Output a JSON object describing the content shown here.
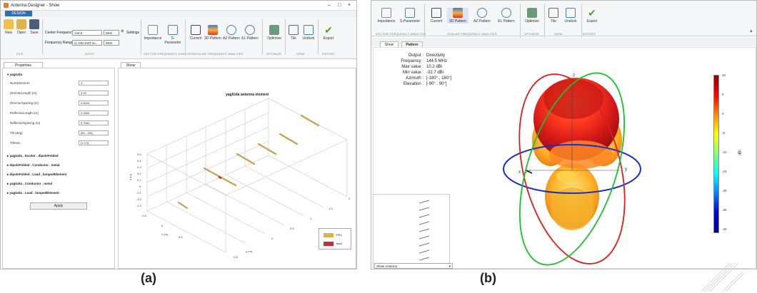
{
  "panel_a": {
    "caption": "(a)",
    "window": {
      "title": "Antenna Designer - Show",
      "tab": "DESIGN"
    },
    "file_buttons": [
      {
        "label": "New"
      },
      {
        "label": "Open"
      },
      {
        "label": "Save"
      }
    ],
    "input": {
      "center_frequency_label": "Center Frequency",
      "center_frequency_value": "144.5",
      "center_frequency_unit": "MHz",
      "settings_label": "Settings",
      "frequency_range_label": "Frequency Range",
      "frequency_range_value": "(1.445:154)*1e...",
      "frequency_range_unit": "MHz"
    },
    "analysis_buttons": [
      {
        "label": "Impedance"
      },
      {
        "label": "S-Parameter"
      },
      {
        "label": "Current"
      },
      {
        "label": "3D Pattern"
      },
      {
        "label": "AZ Pattern"
      },
      {
        "label": "EL Pattern"
      },
      {
        "label": "Optimize"
      },
      {
        "label": "Tile"
      },
      {
        "label": "Undock"
      },
      {
        "label": "Export"
      }
    ],
    "sections": [
      "FILE",
      "INPUT",
      "VECTOR FREQUENCY ANALYSIS",
      "SCALAR FREQUENCY ANALYSIS",
      "OPTIMIZE",
      "VIEW",
      "EXPORT"
    ],
    "properties": {
      "tab": "Properties",
      "group": "yagiUda",
      "rows": [
        {
          "label": "NumDirectors",
          "value": "4"
        },
        {
          "label": "DirectorLength (m)",
          "value": "0.93"
        },
        {
          "label": "DirectorSpacing (m)",
          "value": "0.4920"
        },
        {
          "label": "ReflectorLength (m)",
          "value": "0.2500"
        },
        {
          "label": "ReflectorSpacing (m)",
          "value": "0.7081"
        },
        {
          "label": "Tilt (deg)",
          "value": "[90 - 115]"
        },
        {
          "label": "TiltAxis",
          "value": "[1 0 0]"
        }
      ],
      "groups": [
        "yagiUda . Exciter . dipoleFolded",
        "dipoleFolded . Conductor . metal",
        "dipoleFolded . Load . lumpedElement",
        "yagiUda . Conductor . metal",
        "yagiUda . Load . lumpedElement"
      ],
      "apply": "Apply"
    },
    "show": {
      "tab": "Show",
      "plot_title": "yagiUda antenna element",
      "z_label": "z (m)",
      "x_label": "x (m)",
      "y_label": "y (m)",
      "z_ticks": [
        "0.5",
        "0.4",
        "0.3",
        "0.2",
        "0.1",
        "0",
        "-0.1",
        "-0.2",
        "-0.3"
      ],
      "x_ticks": [
        "-0.5",
        "0",
        "0.5"
      ],
      "y_ticks": [
        "-0.5",
        "0",
        "0.5",
        "1",
        "1.5",
        "2"
      ],
      "legend": [
        {
          "label": "PEC",
          "color": "#d9b44a"
        },
        {
          "label": "feed",
          "color": "#c0303a"
        }
      ]
    }
  },
  "panel_b": {
    "caption": "(b)",
    "ribbon_buttons": [
      {
        "label": "Impedance"
      },
      {
        "label": "S-Parameter"
      },
      {
        "label": "Current"
      },
      {
        "label": "3D Pattern"
      },
      {
        "label": "AZ Pattern"
      },
      {
        "label": "EL Pattern"
      },
      {
        "label": "Optimize"
      },
      {
        "label": "Tile"
      },
      {
        "label": "Undock"
      },
      {
        "label": "Export"
      }
    ],
    "sections": [
      "VECTOR FREQUENCY ANALYSIS",
      "SCALAR FREQUENCY ANALYSIS",
      "OPTIMIZE",
      "VIEW",
      "EXPORT"
    ],
    "tabs": [
      "Show",
      "Pattern"
    ],
    "info": [
      {
        "label": "Output :",
        "value": "Directivity"
      },
      {
        "label": "Frequency :",
        "value": "144.5 MHz"
      },
      {
        "label": "Max value :",
        "value": "10.2 dBi"
      },
      {
        "label": "Min value :",
        "value": "-32.7 dBi"
      },
      {
        "label": "Azimuth :",
        "value": "[-180° , 180°]"
      },
      {
        "label": "Elevation :",
        "value": "[-90° , 90°]"
      }
    ],
    "axis_labels": {
      "x": "x",
      "y": "y",
      "z": "z"
    },
    "colorbar": {
      "unit": "dBi",
      "ticks": [
        "10",
        "5",
        "0",
        "-5",
        "-10",
        "-15",
        "-20",
        "-25",
        "-30"
      ]
    },
    "show_antenna": "Show Antenna"
  }
}
